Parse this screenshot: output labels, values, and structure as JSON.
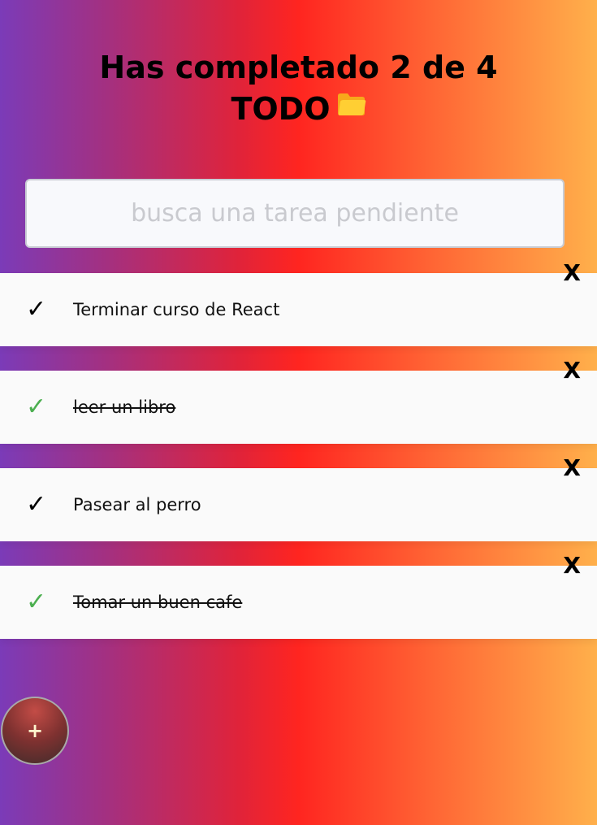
{
  "header": {
    "title_line1": "Has completado 2 de 4",
    "title_line2": "TODO",
    "title_icon": "folder-icon",
    "completed": 2,
    "total": 4
  },
  "search": {
    "placeholder": "busca una tarea pendiente",
    "value": ""
  },
  "todos": [
    {
      "text": "Terminar curso de React",
      "completed": false,
      "check_label": "✓",
      "delete_label": "X"
    },
    {
      "text": "leer un libro",
      "completed": true,
      "check_label": "✓",
      "delete_label": "X"
    },
    {
      "text": "Pasear al perro",
      "completed": false,
      "check_label": "✓",
      "delete_label": "X"
    },
    {
      "text": "Tomar un buen cafe",
      "completed": true,
      "check_label": "✓",
      "delete_label": "X"
    }
  ],
  "add_button": {
    "label": "+"
  },
  "colors": {
    "background_gradient": [
      "#7b3bb8",
      "#a43080",
      "#e0233a",
      "#ff2520",
      "#ff6434",
      "#ffb04b"
    ],
    "completed_check": "#4caf50",
    "pending_check": "#000000",
    "item_background": "#fafafa",
    "add_button": "#7e3130"
  }
}
